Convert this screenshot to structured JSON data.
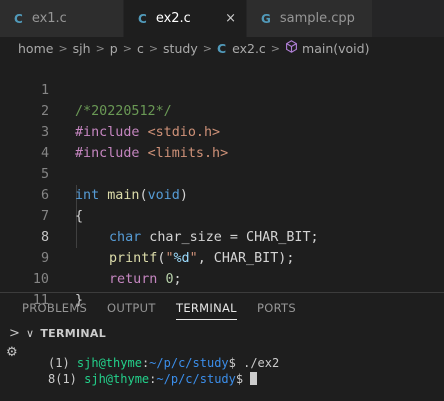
{
  "tabs": [
    {
      "icon": "C",
      "label": "ex1.c"
    },
    {
      "icon": "C",
      "label": "ex2.c",
      "close": "×"
    },
    {
      "icon": "G",
      "label": "sample.cpp"
    }
  ],
  "breadcrumb": [
    "home",
    "sjh",
    "p",
    "c",
    "study",
    "ex2.c",
    "main(void)"
  ],
  "breadcrumb_file_icon": "C",
  "editor": {
    "line_numbers": [
      "1",
      "2",
      "3",
      "4",
      "5",
      "6",
      "7",
      "8",
      "9",
      "10",
      "11"
    ],
    "l1": "/*20220512*/",
    "l2_pp": "#include",
    "l2_inc": "<stdio.h>",
    "l3_pp": "#include",
    "l3_inc": "<limits.h>",
    "l5_kw": "int",
    "l5_fn": "main",
    "l5_p1": "(",
    "l5_kw2": "void",
    "l5_p2": ")",
    "l6": "{",
    "l7_kw": "char",
    "l7_rest": " char_size = CHAR_BIT;",
    "l8_fn": "printf",
    "l8_p1": "(",
    "l8_s1": "\"",
    "l8_fmt": "%d",
    "l8_s2": "\"",
    "l8_rest": ", CHAR_BIT);",
    "l9_kw": "return",
    "l9_num": "0",
    "l9_semi": ";",
    "l10": "}"
  },
  "panel": {
    "tabs": [
      "PROBLEMS",
      "OUTPUT",
      "TERMINAL",
      "PORTS"
    ],
    "terminal_header": "TERMINAL",
    "chevron": "∨",
    "lines": [
      {
        "prefix": "(1) ",
        "user": "sjh@thyme",
        "colon": ":",
        "path": "~/p/c/study",
        "tail": "$ ./ex2"
      },
      {
        "prefix": "8(1) ",
        "user": "sjh@thyme",
        "colon": ":",
        "path": "~/p/c/study",
        "tail": "$ "
      }
    ]
  },
  "side_glyphs": {
    "chevron": ">",
    "debug": "⚙"
  },
  "colors": {
    "accent_c_icon": "#519aba",
    "comment": "#6a9955",
    "keyword": "#569cd6"
  }
}
